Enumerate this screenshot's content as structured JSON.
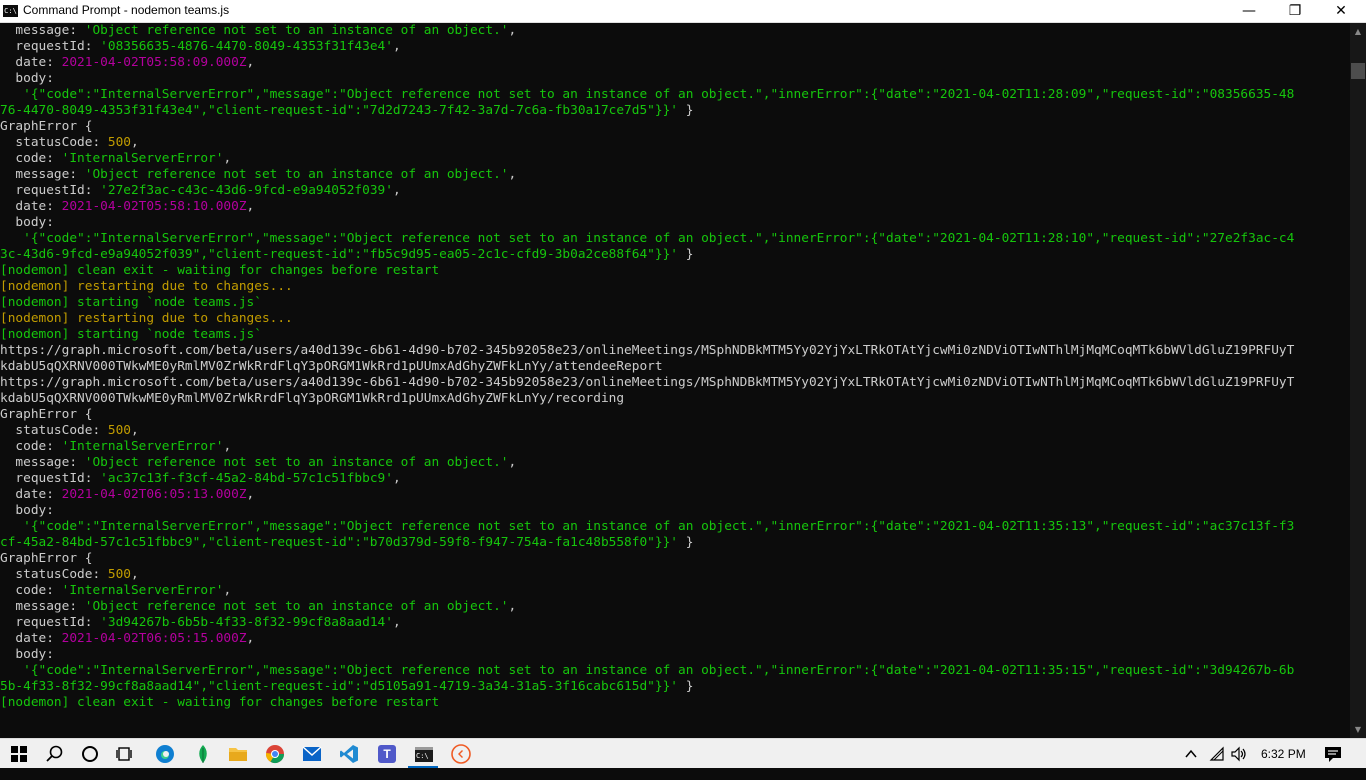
{
  "window": {
    "title": "Command Prompt - nodemon  teams.js",
    "app_icon": "C:\\"
  },
  "controls": {
    "minimize": "—",
    "maximize": "❐",
    "close": "✕"
  },
  "console_lines": [
    [
      {
        "t": "  message: ",
        "c": "w"
      },
      {
        "t": "'Object reference not set to an instance of an object.'",
        "c": "g"
      },
      {
        "t": ",",
        "c": "w"
      }
    ],
    [
      {
        "t": "  requestId: ",
        "c": "w"
      },
      {
        "t": "'08356635-4876-4470-8049-4353f31f43e4'",
        "c": "g"
      },
      {
        "t": ",",
        "c": "w"
      }
    ],
    [
      {
        "t": "  date: ",
        "c": "w"
      },
      {
        "t": "2021-04-02T05:58:09.000Z",
        "c": "m"
      },
      {
        "t": ",",
        "c": "w"
      }
    ],
    [
      {
        "t": "  body:",
        "c": "w"
      }
    ],
    [
      {
        "t": "   '{\"code\":\"InternalServerError\",\"message\":\"Object reference not set to an instance of an object.\",\"innerError\":{\"date\":\"2021-04-02T11:28:09\",\"request-id\":\"08356635-48",
        "c": "g"
      }
    ],
    [
      {
        "t": "76-4470-8049-4353f31f43e4\",\"client-request-id\":\"7d2d7243-7f42-3a7d-7c6a-fb30a17ce7d5\"}}'",
        "c": "g"
      },
      {
        "t": " }",
        "c": "w"
      }
    ],
    [
      {
        "t": "GraphError {",
        "c": "w"
      }
    ],
    [
      {
        "t": "  statusCode: ",
        "c": "w"
      },
      {
        "t": "500",
        "c": "y"
      },
      {
        "t": ",",
        "c": "w"
      }
    ],
    [
      {
        "t": "  code: ",
        "c": "w"
      },
      {
        "t": "'InternalServerError'",
        "c": "g"
      },
      {
        "t": ",",
        "c": "w"
      }
    ],
    [
      {
        "t": "  message: ",
        "c": "w"
      },
      {
        "t": "'Object reference not set to an instance of an object.'",
        "c": "g"
      },
      {
        "t": ",",
        "c": "w"
      }
    ],
    [
      {
        "t": "  requestId: ",
        "c": "w"
      },
      {
        "t": "'27e2f3ac-c43c-43d6-9fcd-e9a94052f039'",
        "c": "g"
      },
      {
        "t": ",",
        "c": "w"
      }
    ],
    [
      {
        "t": "  date: ",
        "c": "w"
      },
      {
        "t": "2021-04-02T05:58:10.000Z",
        "c": "m"
      },
      {
        "t": ",",
        "c": "w"
      }
    ],
    [
      {
        "t": "  body:",
        "c": "w"
      }
    ],
    [
      {
        "t": "   '{\"code\":\"InternalServerError\",\"message\":\"Object reference not set to an instance of an object.\",\"innerError\":{\"date\":\"2021-04-02T11:28:10\",\"request-id\":\"27e2f3ac-c4",
        "c": "g"
      }
    ],
    [
      {
        "t": "3c-43d6-9fcd-e9a94052f039\",\"client-request-id\":\"fb5c9d95-ea05-2c1c-cfd9-3b0a2ce88f64\"}}'",
        "c": "g"
      },
      {
        "t": " }",
        "c": "w"
      }
    ],
    [
      {
        "t": "[nodemon] clean exit - waiting for changes before restart",
        "c": "g"
      }
    ],
    [
      {
        "t": "[nodemon] restarting due to changes...",
        "c": "y"
      }
    ],
    [
      {
        "t": "[nodemon] starting `node teams.js`",
        "c": "g"
      }
    ],
    [
      {
        "t": "[nodemon] restarting due to changes...",
        "c": "y"
      }
    ],
    [
      {
        "t": "[nodemon] starting `node teams.js`",
        "c": "g"
      }
    ],
    [
      {
        "t": "https://graph.microsoft.com/beta/users/a40d139c-6b61-4d90-b702-345b92058e23/onlineMeetings/MSphNDBkMTM5Yy02YjYxLTRkOTAtYjcwMi0zNDViOTIwNThlMjMqMCoqMTk6bWVldGluZ19PRFUyT",
        "c": "w"
      }
    ],
    [
      {
        "t": "kdabU5qQXRNV000TWkwME0yRmlMV0ZrWkRrdFlqY3pORGM1WkRrd1pUUmxAdGhyZWFkLnYy/attendeeReport",
        "c": "w"
      }
    ],
    [
      {
        "t": "https://graph.microsoft.com/beta/users/a40d139c-6b61-4d90-b702-345b92058e23/onlineMeetings/MSphNDBkMTM5Yy02YjYxLTRkOTAtYjcwMi0zNDViOTIwNThlMjMqMCoqMTk6bWVldGluZ19PRFUyT",
        "c": "w"
      }
    ],
    [
      {
        "t": "kdabU5qQXRNV000TWkwME0yRmlMV0ZrWkRrdFlqY3pORGM1WkRrd1pUUmxAdGhyZWFkLnYy/recording",
        "c": "w"
      }
    ],
    [
      {
        "t": "GraphError {",
        "c": "w"
      }
    ],
    [
      {
        "t": "  statusCode: ",
        "c": "w"
      },
      {
        "t": "500",
        "c": "y"
      },
      {
        "t": ",",
        "c": "w"
      }
    ],
    [
      {
        "t": "  code: ",
        "c": "w"
      },
      {
        "t": "'InternalServerError'",
        "c": "g"
      },
      {
        "t": ",",
        "c": "w"
      }
    ],
    [
      {
        "t": "  message: ",
        "c": "w"
      },
      {
        "t": "'Object reference not set to an instance of an object.'",
        "c": "g"
      },
      {
        "t": ",",
        "c": "w"
      }
    ],
    [
      {
        "t": "  requestId: ",
        "c": "w"
      },
      {
        "t": "'ac37c13f-f3cf-45a2-84bd-57c1c51fbbc9'",
        "c": "g"
      },
      {
        "t": ",",
        "c": "w"
      }
    ],
    [
      {
        "t": "  date: ",
        "c": "w"
      },
      {
        "t": "2021-04-02T06:05:13.000Z",
        "c": "m"
      },
      {
        "t": ",",
        "c": "w"
      }
    ],
    [
      {
        "t": "  body:",
        "c": "w"
      }
    ],
    [
      {
        "t": "   '{\"code\":\"InternalServerError\",\"message\":\"Object reference not set to an instance of an object.\",\"innerError\":{\"date\":\"2021-04-02T11:35:13\",\"request-id\":\"ac37c13f-f3",
        "c": "g"
      }
    ],
    [
      {
        "t": "cf-45a2-84bd-57c1c51fbbc9\",\"client-request-id\":\"b70d379d-59f8-f947-754a-fa1c48b558f0\"}}'",
        "c": "g"
      },
      {
        "t": " }",
        "c": "w"
      }
    ],
    [
      {
        "t": "GraphError {",
        "c": "w"
      }
    ],
    [
      {
        "t": "  statusCode: ",
        "c": "w"
      },
      {
        "t": "500",
        "c": "y"
      },
      {
        "t": ",",
        "c": "w"
      }
    ],
    [
      {
        "t": "  code: ",
        "c": "w"
      },
      {
        "t": "'InternalServerError'",
        "c": "g"
      },
      {
        "t": ",",
        "c": "w"
      }
    ],
    [
      {
        "t": "  message: ",
        "c": "w"
      },
      {
        "t": "'Object reference not set to an instance of an object.'",
        "c": "g"
      },
      {
        "t": ",",
        "c": "w"
      }
    ],
    [
      {
        "t": "  requestId: ",
        "c": "w"
      },
      {
        "t": "'3d94267b-6b5b-4f33-8f32-99cf8a8aad14'",
        "c": "g"
      },
      {
        "t": ",",
        "c": "w"
      }
    ],
    [
      {
        "t": "  date: ",
        "c": "w"
      },
      {
        "t": "2021-04-02T06:05:15.000Z",
        "c": "m"
      },
      {
        "t": ",",
        "c": "w"
      }
    ],
    [
      {
        "t": "  body:",
        "c": "w"
      }
    ],
    [
      {
        "t": "   '{\"code\":\"InternalServerError\",\"message\":\"Object reference not set to an instance of an object.\",\"innerError\":{\"date\":\"2021-04-02T11:35:15\",\"request-id\":\"3d94267b-6b",
        "c": "g"
      }
    ],
    [
      {
        "t": "5b-4f33-8f32-99cf8a8aad14\",\"client-request-id\":\"d5105a91-4719-3a34-31a5-3f16cabc615d\"}}'",
        "c": "g"
      },
      {
        "t": " }",
        "c": "w"
      }
    ],
    [
      {
        "t": "[nodemon] clean exit - waiting for changes before restart",
        "c": "g"
      }
    ]
  ],
  "taskbar": {
    "items": [
      "windows-start-icon",
      "search-icon",
      "cortana-icon",
      "task-view-icon",
      "edge-icon",
      "mongodb-compass-icon",
      "file-explorer-icon",
      "chrome-icon",
      "outlook-icon",
      "vscode-icon",
      "teams-icon",
      "command-prompt-icon",
      "postman-icon"
    ],
    "cmd_icon_label": "C:\\",
    "teams_icon_label": "T",
    "clock": "6:32 PM"
  },
  "colors": {
    "green": "#16c60c",
    "yellow": "#c19c00",
    "magenta": "#b4009e",
    "text": "#cccccc",
    "background": "#0c0c0c"
  }
}
